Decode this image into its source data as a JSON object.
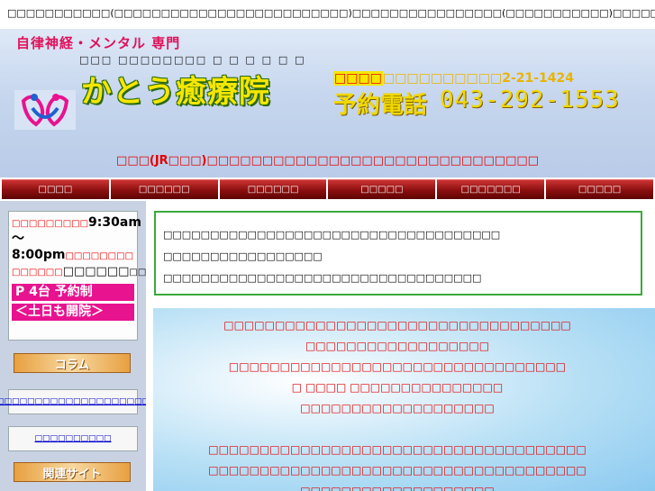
{
  "top_line": "□□□□□□□□□□□(□□□□□□□□□□□□□□□□□□□□□□□□□)□□□□□□□□□□□□□□□□(□□□□□□□□□□□)□□□□□□□□",
  "header": {
    "tagline": "自律神経・メンタル 専門",
    "subname": "□□□ □□□□□□□□ □ □ □ □ □ □",
    "clinic_name": "かとう癒療院",
    "address_highlight": "□□□□",
    "address_text": "□□□□□□□□□□2-21-1424",
    "tel_label": "予約電話",
    "tel_number": "043-292-1553",
    "access_line": "□□□(JR□□□)□□□□□□□□□□□□□□□□□□□□□□□□□□□□□□"
  },
  "nav": {
    "items": [
      "□□□□",
      "□□□□□□",
      "□□□□□□",
      "□□□□□",
      "□□□□□□□",
      "□□□□□"
    ]
  },
  "sidebar": {
    "hours_line1_red": "□□□□□□□□□",
    "hours_time1": "9:30am",
    "hours_tilde": "～",
    "hours_time2": "8:00pm",
    "hours_line2_red": "□□□□□□□□",
    "hours_line3_red": "□□□□□□",
    "hours_line3_black": "□□□□□□",
    "hours_line3_tail": "□□□□",
    "parking": "P 4台 予約制",
    "weekend": "＜土日も開院＞",
    "column_banner": "コラム",
    "link1": "□□□□□□□□□□□□□□□□□□□□□□",
    "link2": "□□□□□□□□□□",
    "related_banner": "関連サイト"
  },
  "notice": {
    "line1": "□□□□□□□□□□□□□□□□□□□□□□□□□□□□□□□□□□□□",
    "line2": "□□□□□□□□□□□□□□□□□",
    "line3": "□□□□□□□□□□□□□□□□□□□□□□□□□□□□□□□□□□"
  },
  "sky_text": {
    "line1": "□□□□□□□□□□□□□□□□□□□□□□□□□□□□□□□□□□",
    "line2": "□□□□□□□□□□□□□□□□□□",
    "line3": "□□□□□□□□□□□□□□□□□□□□□□□□□□□□□□□□□",
    "line4": "□ □□□□ □□□□□□□□□□□□□□□",
    "line5": "□□□□□□□□□□□□□□□□□□□",
    "line6": "",
    "line7": "□□□□□□□□□□□□□□□□□□□□□□□□□□□□□□□□□□□□□",
    "line8": "□□□□□□□□□□□□□□□□□□□□□□□□□□□□□□□□□□□□□",
    "line9": "□□□□□□□□□□□□□□□□□□□"
  },
  "colors": {
    "nav_red": "#8a0e0e",
    "accent_pink": "#e8138f",
    "text_red": "#e00000",
    "notice_border": "#3aaa3a"
  }
}
